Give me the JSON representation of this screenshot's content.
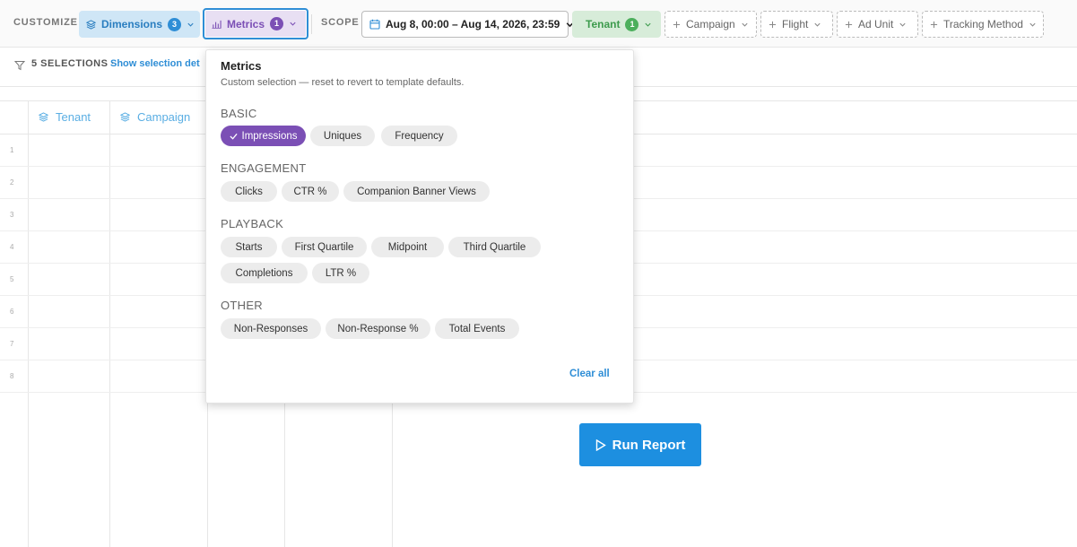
{
  "toolbar": {
    "customize_label": "CUSTOMIZE",
    "scope_label": "SCOPE",
    "dimensions": {
      "label": "Dimensions",
      "count": "3"
    },
    "metrics": {
      "label": "Metrics",
      "count": "1"
    },
    "date_range": "Aug 8, 00:00 – Aug 14, 2026, 23:59",
    "tenant": {
      "label": "Tenant",
      "count": "1"
    },
    "filters": [
      "Campaign",
      "Flight",
      "Ad Unit",
      "Tracking Method"
    ]
  },
  "selection_bar": {
    "count_text": "5 SELECTIONS ·",
    "link_text": "Show selection det"
  },
  "grid": {
    "columns": [
      "Tenant",
      "Campaign"
    ],
    "row_numbers": [
      "1",
      "2",
      "3",
      "4",
      "5",
      "6",
      "7",
      "8"
    ]
  },
  "run_report_label": "Run Report",
  "metrics_panel": {
    "title": "Metrics",
    "subtitle": "Custom selection — reset to revert to template defaults.",
    "sections": [
      {
        "name": "BASIC",
        "chips": [
          {
            "label": "Impressions",
            "selected": true
          },
          {
            "label": "Uniques",
            "selected": false
          },
          {
            "label": "Frequency",
            "selected": false
          }
        ]
      },
      {
        "name": "ENGAGEMENT",
        "chips": [
          {
            "label": "Clicks",
            "selected": false
          },
          {
            "label": "CTR %",
            "selected": false
          },
          {
            "label": "Companion Banner Views",
            "selected": false
          }
        ]
      },
      {
        "name": "PLAYBACK",
        "chips": [
          {
            "label": "Starts",
            "selected": false
          },
          {
            "label": "First Quartile",
            "selected": false
          },
          {
            "label": "Midpoint",
            "selected": false
          },
          {
            "label": "Third Quartile",
            "selected": false
          },
          {
            "label": "Completions",
            "selected": false
          },
          {
            "label": "LTR %",
            "selected": false
          }
        ]
      },
      {
        "name": "OTHER",
        "chips": [
          {
            "label": "Non-Responses",
            "selected": false
          },
          {
            "label": "Non-Response %",
            "selected": false
          },
          {
            "label": "Total Events",
            "selected": false
          }
        ]
      }
    ],
    "clear_all": "Clear all"
  },
  "colors": {
    "dimensions_accent": "#2f8ed6",
    "metrics_accent": "#7b4fb5",
    "tenant_accent": "#4caf5c",
    "run_button": "#1d8fe0"
  },
  "icons": {
    "dimensions": "layers-icon",
    "metrics": "bar-chart-icon",
    "date": "calendar-icon",
    "filter": "filter-icon",
    "add": "plus-icon",
    "dropdown": "chevron-down-icon",
    "check": "check-icon",
    "run": "play-icon"
  }
}
